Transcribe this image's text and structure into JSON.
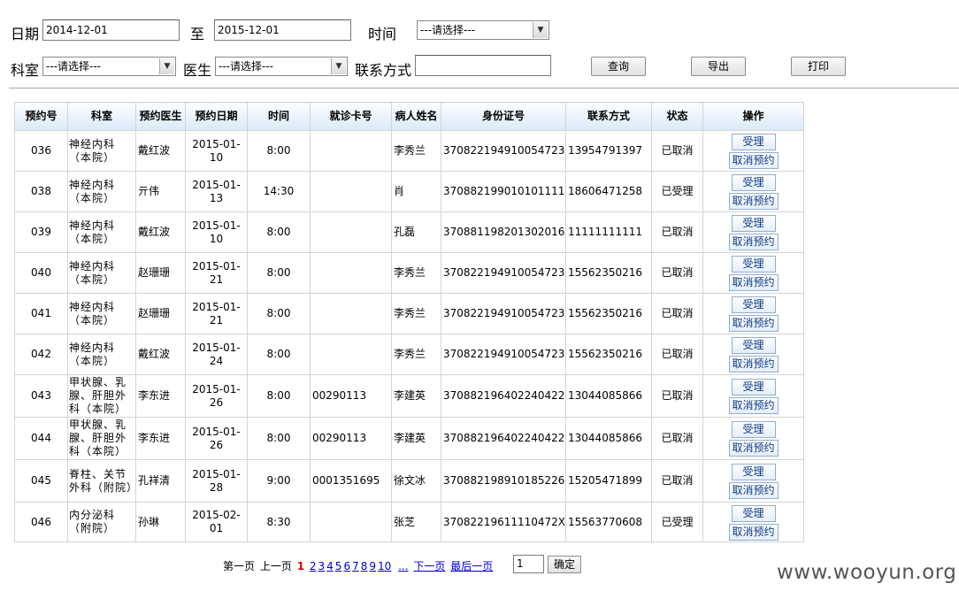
{
  "filters": {
    "date_label": "日期",
    "date_from": "2014-12-01",
    "to_label": "至",
    "date_to": "2015-12-01",
    "time_label": "时间",
    "time_select": "---请选择---",
    "dept_label": "科室",
    "dept_select": "---请选择---",
    "doctor_label": "医生",
    "doctor_select": "---请选择---",
    "contact_label": "联系方式",
    "contact_value": "",
    "query_button": "查询",
    "export_button": "导出",
    "print_button": "打印"
  },
  "table": {
    "headers": [
      "预约号",
      "科室",
      "预约医生",
      "预约日期",
      "时间",
      "就诊卡号",
      "病人姓名",
      "身份证号",
      "联系方式",
      "状态",
      "操作"
    ],
    "accept_label": "受理",
    "cancel_label": "取消预约",
    "rows": [
      {
        "id": "036",
        "dept": "神经内科（本院）",
        "doctor": "戴红波",
        "date": "2015-01-10",
        "time": "8:00",
        "card": "",
        "name": "李秀兰",
        "idno": "370822194910054723",
        "phone": "13954791397",
        "status": "已取消"
      },
      {
        "id": "038",
        "dept": "神经内科（本院）",
        "doctor": "亓伟",
        "date": "2015-01-13",
        "time": "14:30",
        "card": "",
        "name": "肖",
        "idno": "370882199010101111",
        "phone": "18606471258",
        "status": "已受理"
      },
      {
        "id": "039",
        "dept": "神经内科（本院）",
        "doctor": "戴红波",
        "date": "2015-01-10",
        "time": "8:00",
        "card": "",
        "name": "孔磊",
        "idno": "370881198201302016",
        "phone": "11111111111",
        "status": "已取消"
      },
      {
        "id": "040",
        "dept": "神经内科（本院）",
        "doctor": "赵珊珊",
        "date": "2015-01-21",
        "time": "8:00",
        "card": "",
        "name": "李秀兰",
        "idno": "370822194910054723",
        "phone": "15562350216",
        "status": "已取消"
      },
      {
        "id": "041",
        "dept": "神经内科（本院）",
        "doctor": "赵珊珊",
        "date": "2015-01-21",
        "time": "8:00",
        "card": "",
        "name": "李秀兰",
        "idno": "370822194910054723",
        "phone": "15562350216",
        "status": "已取消"
      },
      {
        "id": "042",
        "dept": "神经内科（本院）",
        "doctor": "戴红波",
        "date": "2015-01-24",
        "time": "8:00",
        "card": "",
        "name": "李秀兰",
        "idno": "370822194910054723",
        "phone": "15562350216",
        "status": "已取消"
      },
      {
        "id": "043",
        "dept": "甲状腺、乳腺、肝胆外科（本院）",
        "doctor": "李东进",
        "date": "2015-01-26",
        "time": "8:00",
        "card": "00290113",
        "name": "李建英",
        "idno": "370882196402240422",
        "phone": "13044085866",
        "status": "已取消"
      },
      {
        "id": "044",
        "dept": "甲状腺、乳腺、肝胆外科（本院）",
        "doctor": "李东进",
        "date": "2015-01-26",
        "time": "8:00",
        "card": "00290113",
        "name": "李建英",
        "idno": "370882196402240422",
        "phone": "13044085866",
        "status": "已取消"
      },
      {
        "id": "045",
        "dept": "脊柱、关节外科（附院）",
        "doctor": "孔祥清",
        "date": "2015-01-28",
        "time": "9:00",
        "card": "0001351695",
        "name": "徐文冰",
        "idno": "370882198910185226",
        "phone": "15205471899",
        "status": "已取消"
      },
      {
        "id": "046",
        "dept": "内分泌科（附院）",
        "doctor": "孙琳",
        "date": "2015-02-01",
        "time": "8:30",
        "card": "",
        "name": "张芝",
        "idno": "37082219611110472X",
        "phone": "15563770608",
        "status": "已受理"
      }
    ]
  },
  "pager": {
    "first": "第一页",
    "prev": "上一页",
    "current": "1",
    "pages": [
      "2",
      "3",
      "4",
      "5",
      "6",
      "7",
      "8",
      "9",
      "10"
    ],
    "ellipsis": "...",
    "next": "下一页",
    "last": "最后一页",
    "page_input": "1",
    "go_button": "确定"
  },
  "watermark": "www.wooyun.org"
}
